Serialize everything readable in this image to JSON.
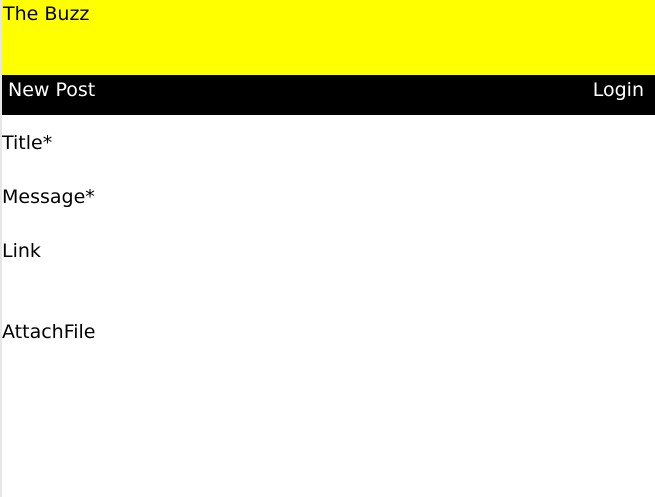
{
  "header": {
    "title": "The Buzz"
  },
  "nav": {
    "new_post": "New Post",
    "login": "Login"
  },
  "form": {
    "title_label": "Title*",
    "message_label": "Message*",
    "link_label": "Link",
    "attach_label": "AttachFile"
  },
  "colors": {
    "header_bg": "#ffff00",
    "nav_bg": "#000000"
  }
}
